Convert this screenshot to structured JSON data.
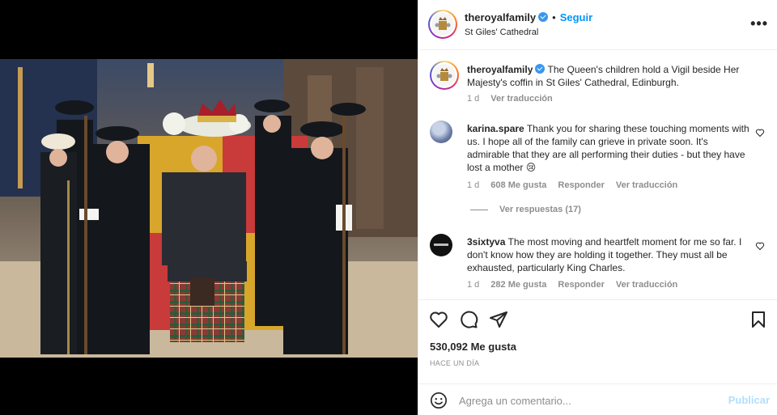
{
  "header": {
    "username": "theroyalfamily",
    "separator": "•",
    "follow_label": "Seguir",
    "location": "St Giles' Cathedral",
    "more_label": "•••"
  },
  "caption": {
    "username": "theroyalfamily",
    "text": "The Queen's children hold a Vigil beside Her Majesty's coffin in St Giles' Cathedral, Edinburgh.",
    "time": "1 d",
    "translate": "Ver traducción"
  },
  "comments": [
    {
      "username": "karina.spare",
      "text": "Thank you for sharing these touching moments with us. I hope all of the family can grieve in private soon. It's admirable that they are all performing their duties - but they have lost a mother 😢",
      "time": "1 d",
      "likes": "608 Me gusta",
      "reply": "Responder",
      "translate": "Ver traducción"
    },
    {
      "username": "3sixtyva",
      "text": "The most moving and heartfelt moment for me so far. I don't know how they are holding it together. They must all be exhausted, particularly King Charles.",
      "time": "1 d",
      "likes": "282 Me gusta",
      "reply": "Responder",
      "translate": "Ver traducción"
    }
  ],
  "replies_label": "Ver respuestas (17)",
  "post": {
    "likes": "530,092 Me gusta",
    "ago": "HACE UN DÍA"
  },
  "add_comment": {
    "placeholder": "Agrega un comentario...",
    "publish": "Publicar"
  },
  "icons": {
    "like": "heart-icon",
    "comment": "comment-icon",
    "share": "share-icon",
    "save": "bookmark-icon",
    "emoji": "emoji-icon",
    "more": "more-icon",
    "verified": "verified-badge-icon"
  },
  "colors": {
    "accent": "#0095f6",
    "publish_disabled": "#b2dffc",
    "secondary_text": "#8e8e8e"
  }
}
